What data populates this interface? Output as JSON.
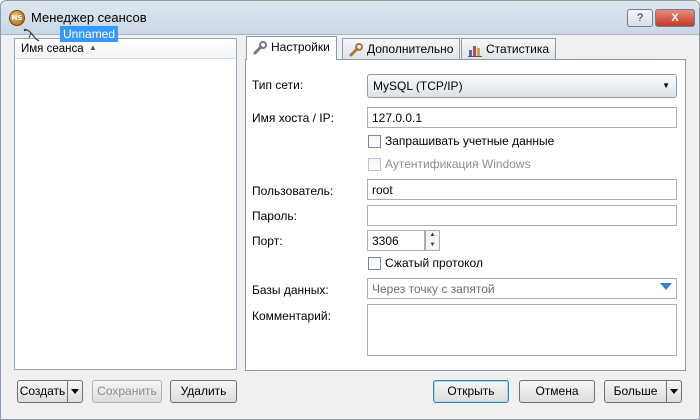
{
  "window": {
    "title": "Менеджер сеансов",
    "app_icon_text": "HS",
    "help_button": "?",
    "close_button": "X"
  },
  "tree": {
    "header_label": "Имя сеанса",
    "sort_icon": "▲",
    "items": [
      {
        "label": "Unnamed",
        "icon": "session-icon",
        "selected": true
      }
    ]
  },
  "tabs": [
    {
      "label": "Настройки",
      "icon": "wrench-icon",
      "active": true
    },
    {
      "label": "Дополнительно",
      "icon": "wrench-icon",
      "active": false
    },
    {
      "label": "Статистика",
      "icon": "bar-chart-icon",
      "active": false
    }
  ],
  "form": {
    "network_type_label": "Тип сети:",
    "network_type_value": "MySQL (TCP/IP)",
    "host_label": "Имя хоста / IP:",
    "host_value": "127.0.0.1",
    "prompt_credentials_label": "Запрашивать учетные данные",
    "prompt_credentials_checked": false,
    "windows_auth_label": "Аутентификация Windows",
    "windows_auth_checked": false,
    "user_label": "Пользователь:",
    "user_value": "root",
    "password_label": "Пароль:",
    "password_value": "",
    "port_label": "Порт:",
    "port_value": "3306",
    "compressed_label": "Сжатый протокол",
    "compressed_checked": false,
    "databases_label": "Базы данных:",
    "databases_placeholder": "Через точку с запятой",
    "comment_label": "Комментарий:",
    "comment_value": ""
  },
  "buttons": {
    "create": "Создать",
    "save": "Сохранить",
    "delete": "Удалить",
    "open": "Открыть",
    "cancel": "Отмена",
    "more": "Больше"
  },
  "colors": {
    "selection": "#3399ff",
    "accent_arrow": "#3b7bd8"
  }
}
